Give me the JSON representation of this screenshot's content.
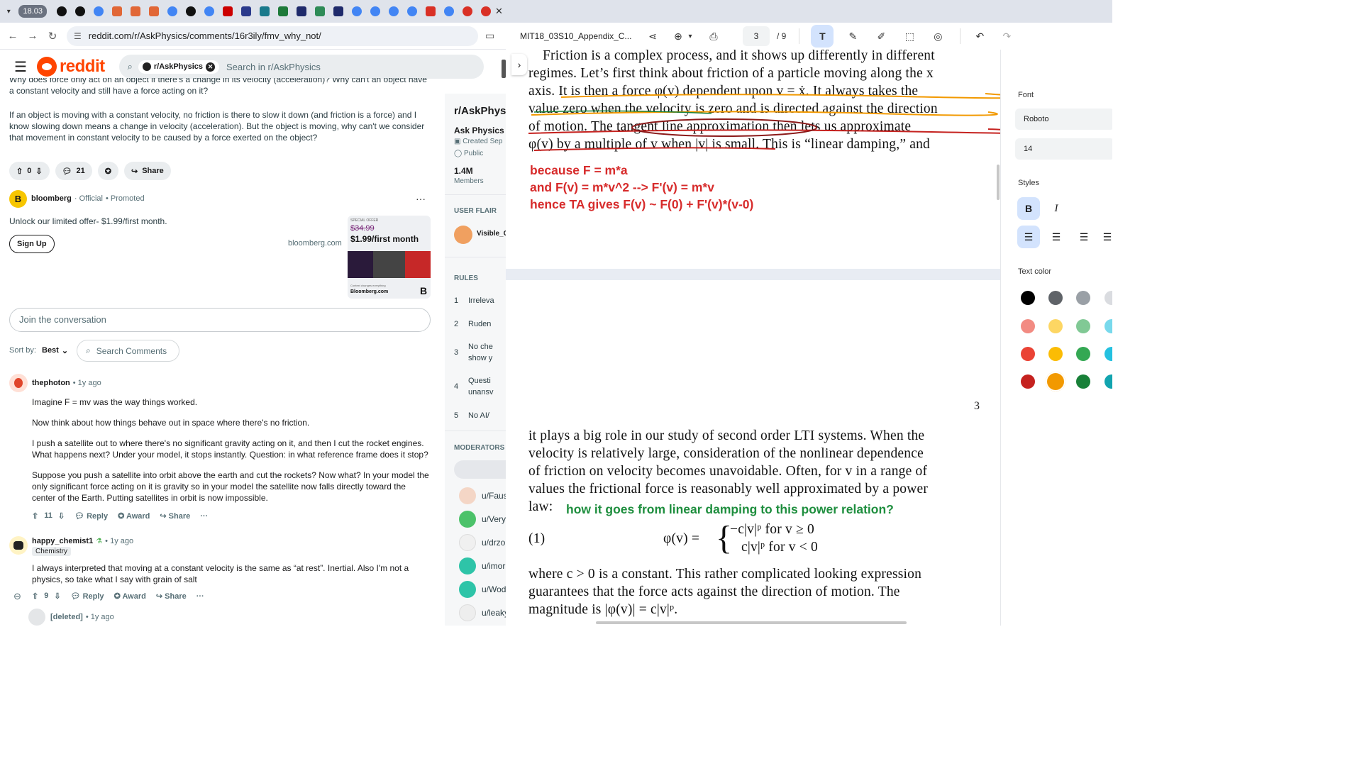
{
  "browser": {
    "group_chip": "18.03",
    "url": "reddit.com/r/AskPhysics/comments/16r3ily/fmv_why_not/"
  },
  "reddit": {
    "logo_text": "reddit",
    "search_chip": "r/AskPhysics",
    "search_placeholder": "Search in r/AskPhysics"
  },
  "post": {
    "body_top": "Why does force only act on an object if there's a change in its velocity (acceleration)? Why can't an object have a constant velocity and still have a force acting on it?",
    "body_p2": "If an object is moving with a constant velocity, no friction is there to slow it down (and friction is a force) and I know slowing down means a change in velocity (acceleration). But the object is moving, why can't we consider that movement in constant velocity to be caused by a force exerted on the object?",
    "votes": "0",
    "comments": "21",
    "share": "Share"
  },
  "ad": {
    "advertiser": "bloomberg",
    "official": "· Official",
    "promoted": "• Promoted",
    "text": "Unlock our limited offer- $1.99/first month.",
    "signup": "Sign Up",
    "domain": "bloomberg.com",
    "special": "SPECIAL OFFER",
    "old_price": "$34.99",
    "new_price": "$1.99/first month",
    "brand": "Bloomberg.com",
    "tag": "Context changes everything"
  },
  "join": "Join the conversation",
  "sort": {
    "label": "Sort by:",
    "value": "Best",
    "search": "Search Comments"
  },
  "comments": [
    {
      "user": "thephoton",
      "time": "• 1y ago",
      "paras": [
        "Imagine F = mv was the way things worked.",
        "Now think about how things behave out in space where there's no friction.",
        "I push a satellite out to where there's no significant gravity acting on it, and then I cut the rocket engines. What happens next? Under your model, it stops instantly. Question: in what reference frame does it stop?",
        "Suppose you push a satellite into orbit above the earth and cut the rockets? Now what? In your model the only significant force acting on it is gravity so in your model the satellite now falls directly toward the center of the Earth. Putting satellites in orbit is now impossible."
      ],
      "votes": "11",
      "reply": "Reply",
      "award": "Award",
      "share": "Share"
    },
    {
      "user": "happy_chemist1",
      "time": "• 1y ago",
      "flair": "Chemistry",
      "paras": [
        "I always interpreted that moving at a constant velocity is the same as “at rest”. Inertial. Also I'm not a physics, so take what I say with grain of salt"
      ],
      "votes": "9",
      "reply": "Reply",
      "award": "Award",
      "share": "Share"
    },
    {
      "user": "[deleted]",
      "time": "• 1y ago"
    }
  ],
  "sidebar": {
    "title": "r/AskPhysi",
    "name": "Ask Physics",
    "created": "Created Sep",
    "public": "Public",
    "members_count": "1.4M",
    "members_label": "Members",
    "user_flair": "USER FLAIR",
    "flair_user": "Visible_C",
    "rules_label": "RULES",
    "rules": [
      {
        "n": "1",
        "t": "Irreleva"
      },
      {
        "n": "2",
        "t": "Ruden"
      },
      {
        "n": "3",
        "t": "No che",
        "t2": "show y"
      },
      {
        "n": "4",
        "t": "Questi",
        "t2": "unansv"
      },
      {
        "n": "5",
        "t": "No AI/"
      }
    ],
    "mods_label": "MODERATORS",
    "mods": [
      "u/Faus",
      "u/Very",
      "u/drzo",
      "u/imor",
      "u/Wod",
      "u/leaky"
    ]
  },
  "pdf": {
    "filename": "MIT18_03S10_Appendix_C...",
    "page": "3",
    "total": "/   9",
    "lines_top": [
      "Friction is a complex process, and it shows up differently in different",
      "regimes.  Let’s first think about friction of a particle moving along the x",
      "axis.  It is then a force φ(v) dependent upon v = ẋ.  It always takes the",
      "value zero when the velocity is zero and is directed against the direction",
      "of motion.  The tangent line approximation then lets us approximate",
      "φ(v) by a multiple of v when |v| is small.  This is “linear damping,” and"
    ],
    "annot_red": [
      "because F = m*a",
      "and F(v) = m*v^2 --> F'(v) = m*v",
      "hence TA gives F(v) ~ F(0) + F'(v)*(v-0)"
    ],
    "page_number": "3",
    "lines_bottom": [
      "it plays a big role in our study of second order LTI systems.  When the",
      "velocity is relatively large, consideration of the nonlinear dependence",
      "of friction on velocity becomes unavoidable.  Often, for v in a range of",
      "values the frictional force is reasonably well approximated by a power"
    ],
    "law": "law:",
    "annot_green": "how it goes from linear damping to this power relation?",
    "eq_num": "(1)",
    "eq_lhs": "φ(v) =",
    "eq_r1": "−c|v|ᵖ   for v ≥ 0",
    "eq_r2": "c|v|ᵖ   for v < 0",
    "lines_end": [
      "where c > 0 is a constant.  This rather complicated looking expression",
      "guarantees that the force acts against the direction of motion.  The",
      "magnitude is |φ(v)| = c|v|ᵖ."
    ]
  },
  "panel": {
    "font_label": "Font",
    "font_value": "Roboto",
    "size_value": "14",
    "styles_label": "Styles",
    "bold": "B",
    "italic": "I",
    "color_label": "Text color",
    "colors": [
      "#000000",
      "#5f6368",
      "#9aa0a6",
      "#dadce0",
      "#f28b82",
      "#fdd663",
      "#81c995",
      "#78d9ec",
      "#ea4335",
      "#fbbc04",
      "#34a853",
      "#24c1e0",
      "#c5221f",
      "#f29900",
      "#188038",
      "#12a4af"
    ]
  }
}
